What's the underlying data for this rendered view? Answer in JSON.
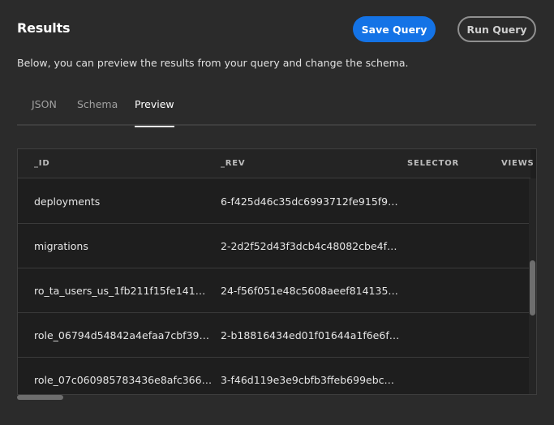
{
  "header": {
    "title": "Results",
    "save_label": "Save Query",
    "run_label": "Run Query",
    "description": "Below, you can preview the results from your query and change the schema."
  },
  "tabs": [
    {
      "label": "JSON",
      "selected": false
    },
    {
      "label": "Schema",
      "selected": false
    },
    {
      "label": "Preview",
      "selected": true
    }
  ],
  "table": {
    "columns": [
      "_ID",
      "_REV",
      "SELECTOR",
      "VIEWS"
    ],
    "rows": [
      {
        "id": "deployments",
        "rev": "6-f425d46c35dc6993712fe915f9…"
      },
      {
        "id": "migrations",
        "rev": "2-2d2f52d43f3dcb4c48082cbe4f…"
      },
      {
        "id": "ro_ta_users_us_1fb211f15fe141…",
        "rev": "24-f56f051e48c5608aeef814135…"
      },
      {
        "id": "role_06794d54842a4efaa7cbf39…",
        "rev": "2-b18816434ed01f01644a1f6e6f…"
      },
      {
        "id": "role_07c060985783436e8afc366…",
        "rev": "3-f46d119e3e9cbfb3ffeb699ebc…"
      }
    ]
  },
  "colors": {
    "background": "#2b2b2b",
    "accent": "#1473e6",
    "table_bg": "#1e1e1e"
  }
}
